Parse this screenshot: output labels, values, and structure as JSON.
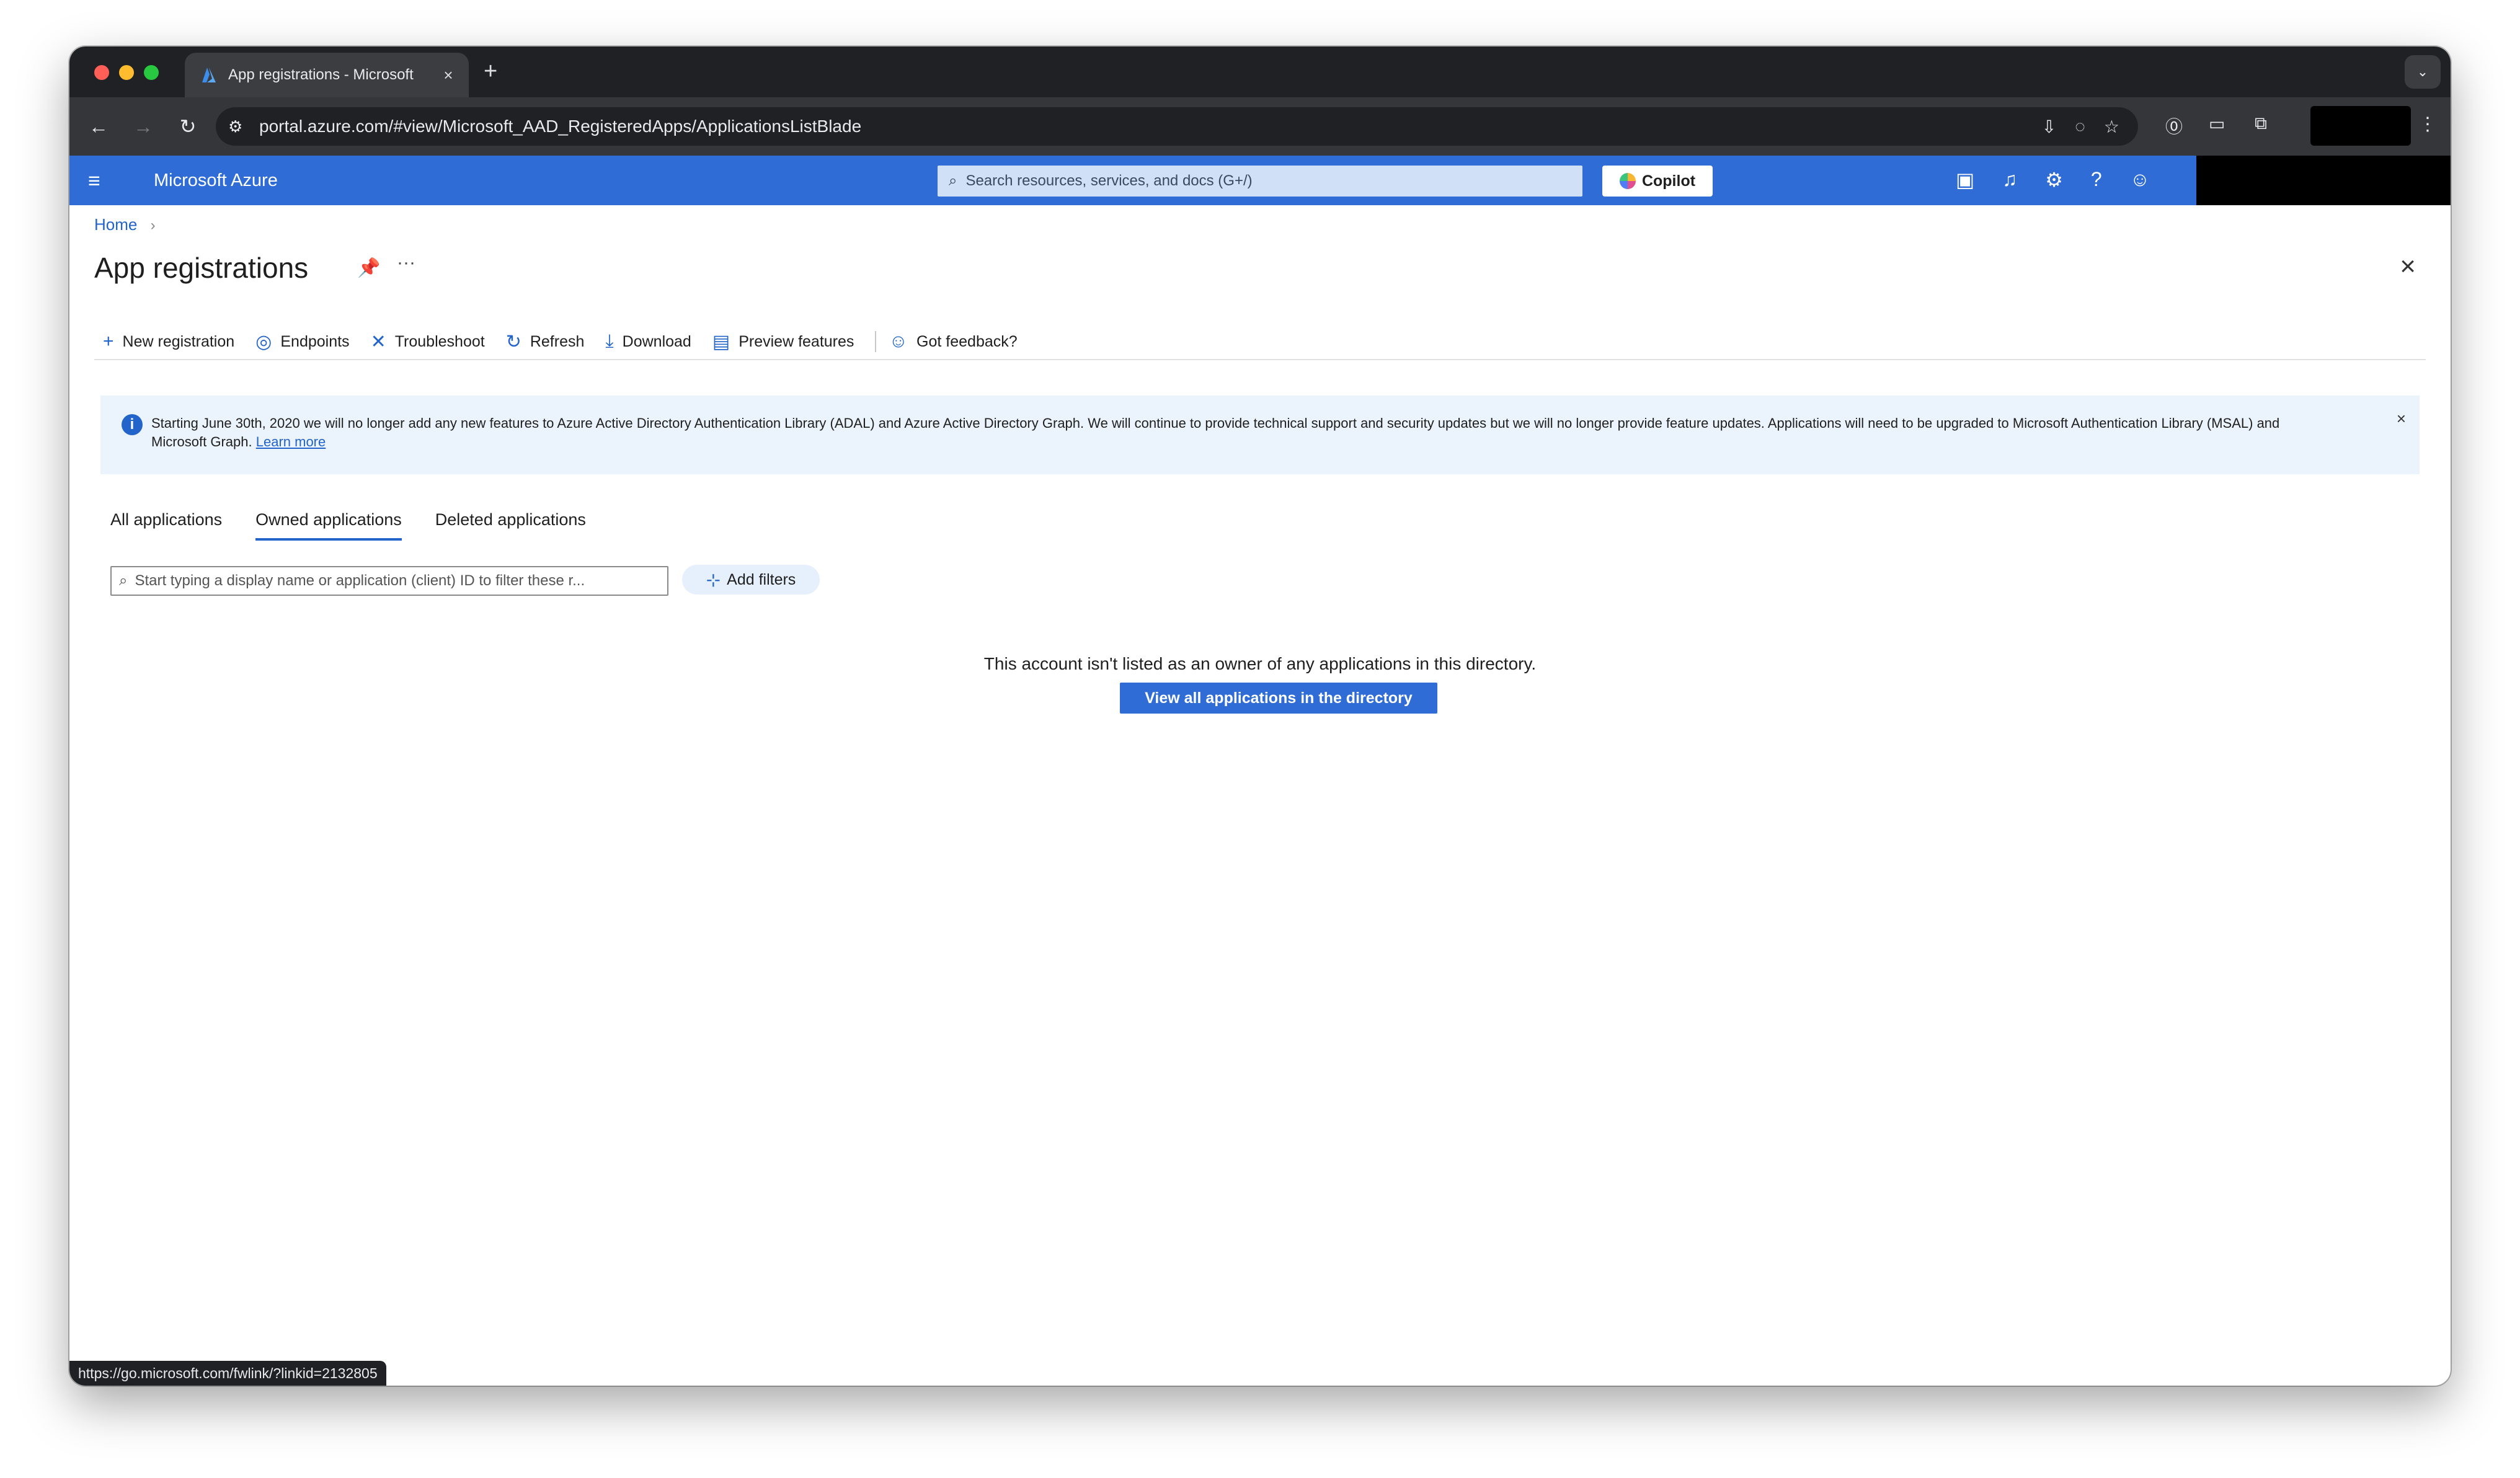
{
  "browser": {
    "tab_title": "App registrations - Microsoft",
    "tab_close": "×",
    "new_tab": "+",
    "tab_menu": "⌄",
    "url": "portal.azure.com/#view/Microsoft_AAD_RegisteredApps/ApplicationsListBlade",
    "status_url": "https://go.microsoft.com/fwlink/?linkid=2132805"
  },
  "azure": {
    "brand": "Microsoft Azure",
    "search_placeholder": "Search resources, services, and docs (G+/)",
    "copilot_label": "Copilot"
  },
  "page": {
    "breadcrumb_home": "Home",
    "title": "App registrations"
  },
  "commands": {
    "new_registration": "New registration",
    "endpoints": "Endpoints",
    "troubleshoot": "Troubleshoot",
    "refresh": "Refresh",
    "download": "Download",
    "preview_features": "Preview features",
    "feedback": "Got feedback?"
  },
  "banner": {
    "text": "Starting June 30th, 2020 we will no longer add any new features to Azure Active Directory Authentication Library (ADAL) and Azure Active Directory Graph. We will continue to provide technical support and security updates but we will no longer provide feature updates. Applications will need to be upgraded to Microsoft Authentication Library (MSAL) and Microsoft Graph.",
    "link": "Learn more"
  },
  "tabs": {
    "all": "All applications",
    "owned": "Owned applications",
    "deleted": "Deleted applications",
    "active": "owned"
  },
  "filter": {
    "placeholder": "Start typing a display name or application (client) ID to filter these r...",
    "add_filters": "Add filters"
  },
  "empty_state": {
    "message": "This account isn't listed as an owner of any applications in this directory.",
    "button": "View all applications in the directory"
  },
  "colors": {
    "azure_blue": "#2f6cd5",
    "link_blue": "#2264c9",
    "banner_bg": "#ebf3fc"
  }
}
